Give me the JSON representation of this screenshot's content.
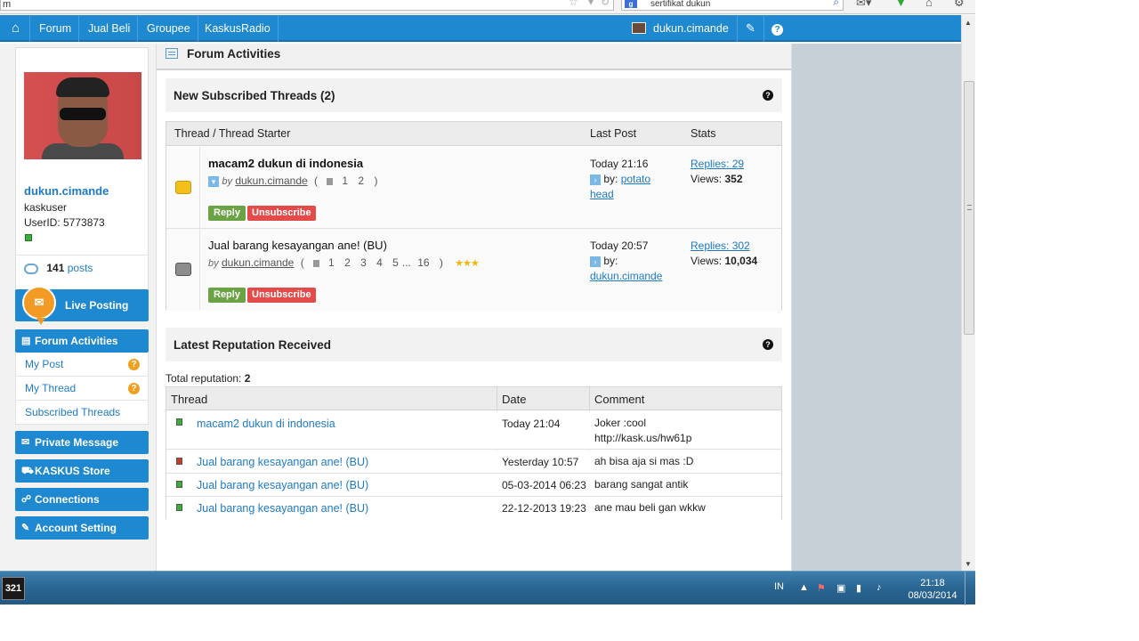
{
  "browser": {
    "url_text": "m",
    "search_text": "sertifikat dukun",
    "search_engine_logo": "g"
  },
  "nav": {
    "home_icon": "home-icon",
    "items": [
      "Forum",
      "Jual Beli",
      "Groupee",
      "KaskusRadio"
    ],
    "username": "dukun.cimande",
    "edit_icon": "pencil-icon",
    "help_icon": "?"
  },
  "profile": {
    "name": "dukun.cimande",
    "role": "kaskuser",
    "user_id": "UserID: 5773873",
    "post_count": "141",
    "posts_label": "posts"
  },
  "sidebar": {
    "live_posting": "Live Posting",
    "forum_activities": "Forum Activities",
    "sub_items": [
      {
        "label": "My Post",
        "alert": "?"
      },
      {
        "label": "My Thread",
        "alert": "?"
      },
      {
        "label": "Subscribed Threads"
      }
    ],
    "private_message": "Private Message",
    "kaskus_store": "KASKUS Store",
    "connections": "Connections",
    "account_setting": "Account Setting"
  },
  "main": {
    "title": "Forum Activities"
  },
  "subscribed": {
    "title": "New Subscribed Threads (2)",
    "help": "?",
    "headers": {
      "thread": "Thread / Thread Starter",
      "last_post": "Last Post",
      "stats": "Stats"
    },
    "threads": [
      {
        "title": "macam2 dukun di indonesia",
        "by_label": "by",
        "starter": "dukun.cimande",
        "pages": [
          "1",
          "2"
        ],
        "last_post_time": "Today 21:16",
        "last_post_by_label": "by:",
        "last_post_by": "potato head",
        "replies": "Replies: 29",
        "views_label": "Views:",
        "views": "352",
        "reply_label": "Reply",
        "unsubscribe_label": "Unsubscribe",
        "icon_color": "#f2c019"
      },
      {
        "title": "Jual barang kesayangan ane! (BU)",
        "by_label": "by",
        "starter": "dukun.cimande",
        "pages": [
          "1",
          "2",
          "3",
          "4",
          "5",
          "...",
          "16"
        ],
        "last_post_time": "Today 20:57",
        "last_post_by_label": "by:",
        "last_post_by": "dukun.cimande",
        "replies": "Replies: 302",
        "views_label": "Views:",
        "views": "10,034",
        "reply_label": "Reply",
        "unsubscribe_label": "Unsubscribe",
        "icon_color": "#8c8c8c",
        "rating_stars": 3
      }
    ]
  },
  "reputation": {
    "title": "Latest Reputation Received",
    "help": "?",
    "total_label": "Total reputation:",
    "total_value": "2",
    "headers": {
      "thread": "Thread",
      "date": "Date",
      "comment": "Comment"
    },
    "rows": [
      {
        "thread": "macam2 dukun di indonesia",
        "date": "Today 21:04",
        "comment": "Joker :cool",
        "comment2": "http://kask.us/hw61p",
        "color": "#3cae3c"
      },
      {
        "thread": "Jual barang kesayangan ane! (BU)",
        "date": "Yesterday 10:57",
        "comment": "ah bisa aja si mas :D",
        "color": "#c83a2a"
      },
      {
        "thread": "Jual barang kesayangan ane! (BU)",
        "date": "05-03-2014 06:23",
        "comment": "barang sangat antik",
        "color": "#3cae3c"
      },
      {
        "thread": "Jual barang kesayangan ane! (BU)",
        "date": "22-12-2013 19:23",
        "comment": "ane mau beli gan wkkw",
        "color": "#3cae3c"
      }
    ]
  },
  "taskbar": {
    "app_label": "321",
    "lang": "IN",
    "time": "21:18",
    "date": "08/03/2014"
  }
}
